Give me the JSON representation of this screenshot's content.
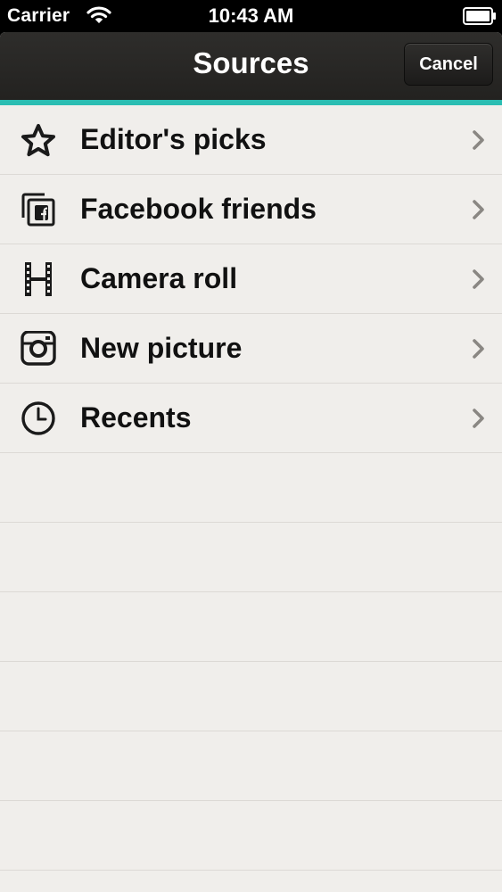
{
  "status_bar": {
    "carrier": "Carrier",
    "time": "10:43 AM",
    "wifi_icon": "wifi-icon",
    "battery_icon": "battery-full-icon"
  },
  "navbar": {
    "title": "Sources",
    "cancel_label": "Cancel",
    "accent_color": "#2bbdb2",
    "bar_color": "#262523"
  },
  "sources": [
    {
      "label": "Editor's picks",
      "icon": "star-icon"
    },
    {
      "label": "Facebook friends",
      "icon": "facebook-friends-icon"
    },
    {
      "label": "Camera roll",
      "icon": "film-strip-icon"
    },
    {
      "label": "New picture",
      "icon": "camera-icon"
    },
    {
      "label": "Recents",
      "icon": "clock-icon"
    }
  ],
  "colors": {
    "list_background": "#f0eeeb",
    "separator": "#dcd9d5",
    "chevron": "#8a8783"
  }
}
